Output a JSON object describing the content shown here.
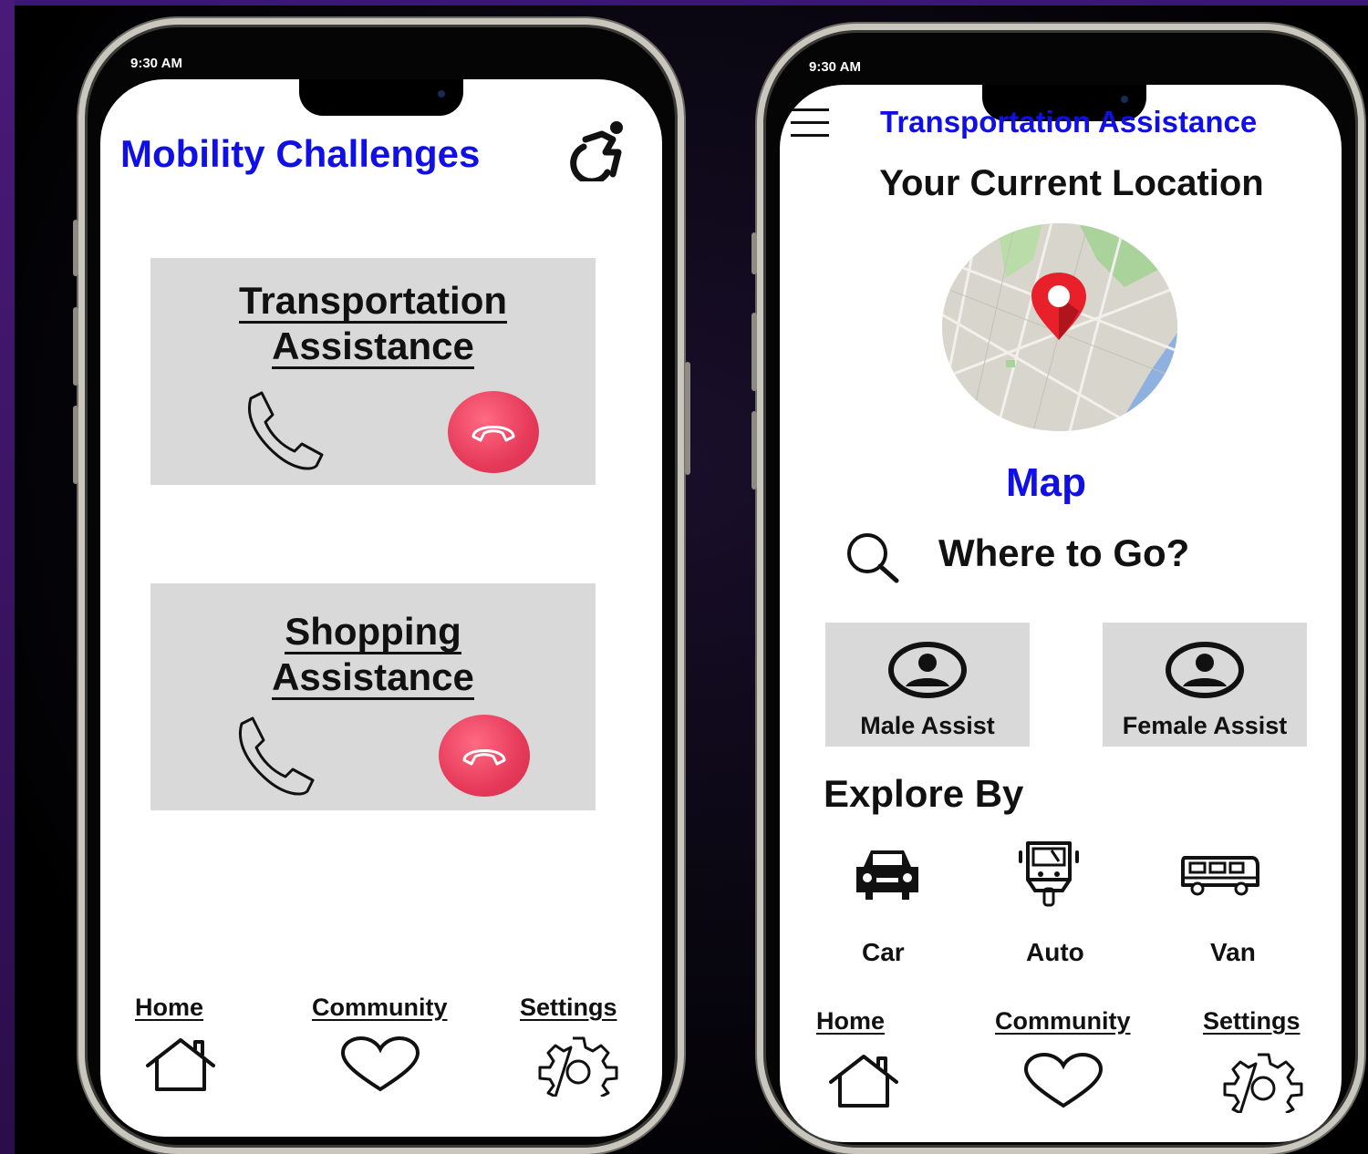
{
  "left_phone": {
    "status_time": "9:30 AM",
    "title": "Mobility Challenges",
    "cards": [
      {
        "title_line1": "Transportation",
        "title_line2": "Assistance"
      },
      {
        "title_line1": "Shopping",
        "title_line2": "Assistance"
      }
    ],
    "nav": {
      "home": "Home",
      "community": "Community",
      "settings": "Settings"
    }
  },
  "right_phone": {
    "status_time": "9:30 AM",
    "title": "Transportation Assistance",
    "location_heading": "Your Current Location",
    "map_label": "Map",
    "search_label": "Where to Go?",
    "assist": {
      "male": "Male Assist",
      "female": "Female Assist"
    },
    "explore_heading": "Explore By",
    "vehicles": {
      "car": "Car",
      "auto": "Auto",
      "van": "Van"
    },
    "nav": {
      "home": "Home",
      "community": "Community",
      "settings": "Settings"
    }
  },
  "colors": {
    "accent_blue": "#1010e6",
    "card_gray": "#d9d9d9",
    "end_call_red": "#e63a5a",
    "map_pin_red": "#e8202a"
  }
}
